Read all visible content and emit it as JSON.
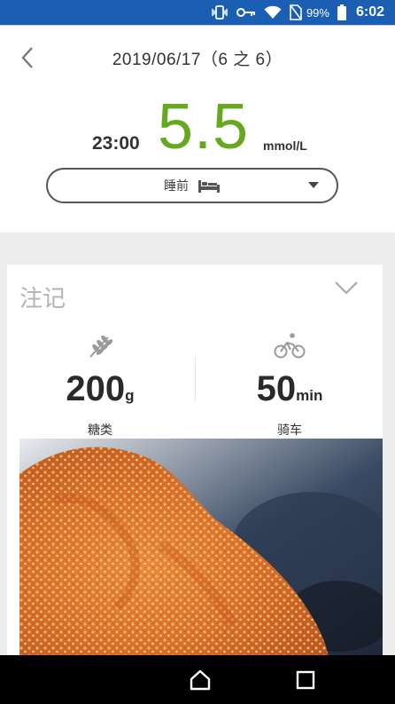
{
  "status_bar": {
    "battery": "99%",
    "time": "6:02"
  },
  "header": {
    "date_title": "2019/06/17（6 之 6）"
  },
  "reading": {
    "time": "23:00",
    "value": "5.5",
    "unit": "mmol/L",
    "value_color": "#66a81f"
  },
  "meal_select": {
    "selected": "睡前",
    "icon": "bed-icon"
  },
  "notes": {
    "title": "注记",
    "carbs": {
      "value": "200",
      "unit": "g",
      "label": "糖类",
      "icon": "wheat-icon"
    },
    "exercise": {
      "value": "50",
      "unit": "min",
      "label": "骑车",
      "icon": "cyclist-icon"
    }
  },
  "colors": {
    "status_bar": "#1a5fb4",
    "accent_green": "#66a81f",
    "nav_bar": "#000000"
  }
}
